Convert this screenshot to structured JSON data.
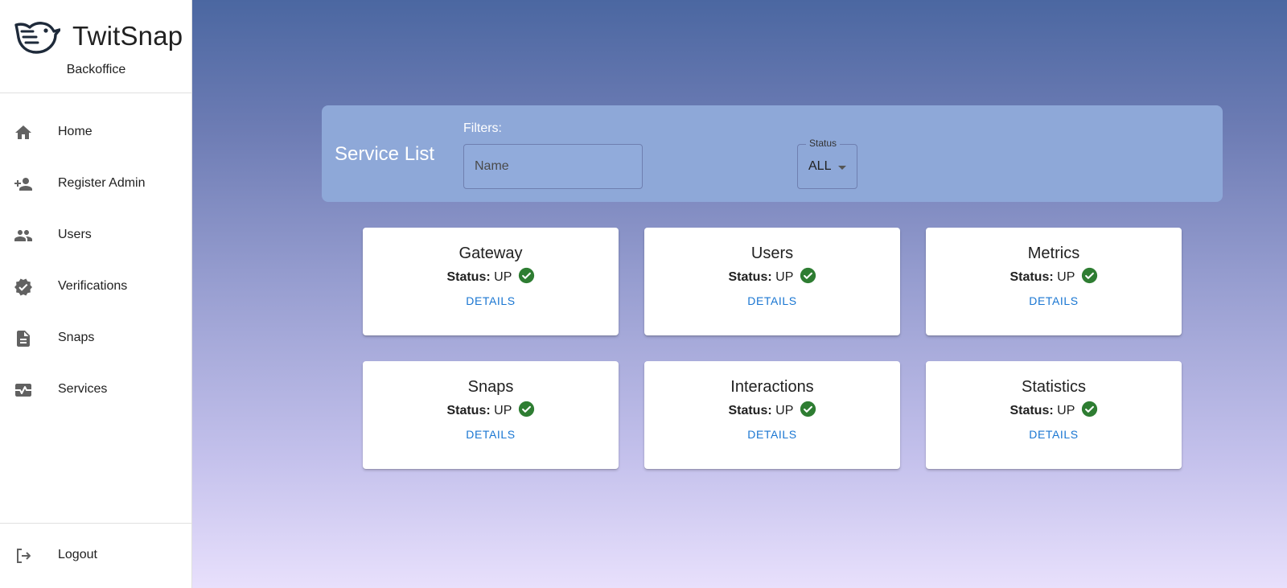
{
  "brand": {
    "name": "TwitSnap",
    "subtitle": "Backoffice"
  },
  "nav": [
    {
      "label": "Home",
      "icon": "home-icon"
    },
    {
      "label": "Register Admin",
      "icon": "person-add-icon"
    },
    {
      "label": "Users",
      "icon": "people-icon"
    },
    {
      "label": "Verifications",
      "icon": "verified-icon"
    },
    {
      "label": "Snaps",
      "icon": "document-icon"
    },
    {
      "label": "Services",
      "icon": "monitor-heart-icon"
    }
  ],
  "logout": {
    "label": "Logout",
    "icon": "logout-icon"
  },
  "toolbar": {
    "title": "Service List",
    "filters_label": "Filters:",
    "name_placeholder": "Name",
    "name_value": "",
    "status_label": "Status",
    "status_value": "ALL"
  },
  "status_prefix": "Status:",
  "details_label": "DETAILS",
  "services": [
    {
      "name": "Gateway",
      "status": "UP"
    },
    {
      "name": "Users",
      "status": "UP"
    },
    {
      "name": "Metrics",
      "status": "UP"
    },
    {
      "name": "Snaps",
      "status": "UP"
    },
    {
      "name": "Interactions",
      "status": "UP"
    },
    {
      "name": "Statistics",
      "status": "UP"
    }
  ],
  "colors": {
    "accent_link": "#1976d2",
    "status_up": "#2e7d32",
    "toolbar_bg": "#8ea8d8",
    "logo": "#1e2a3a"
  }
}
